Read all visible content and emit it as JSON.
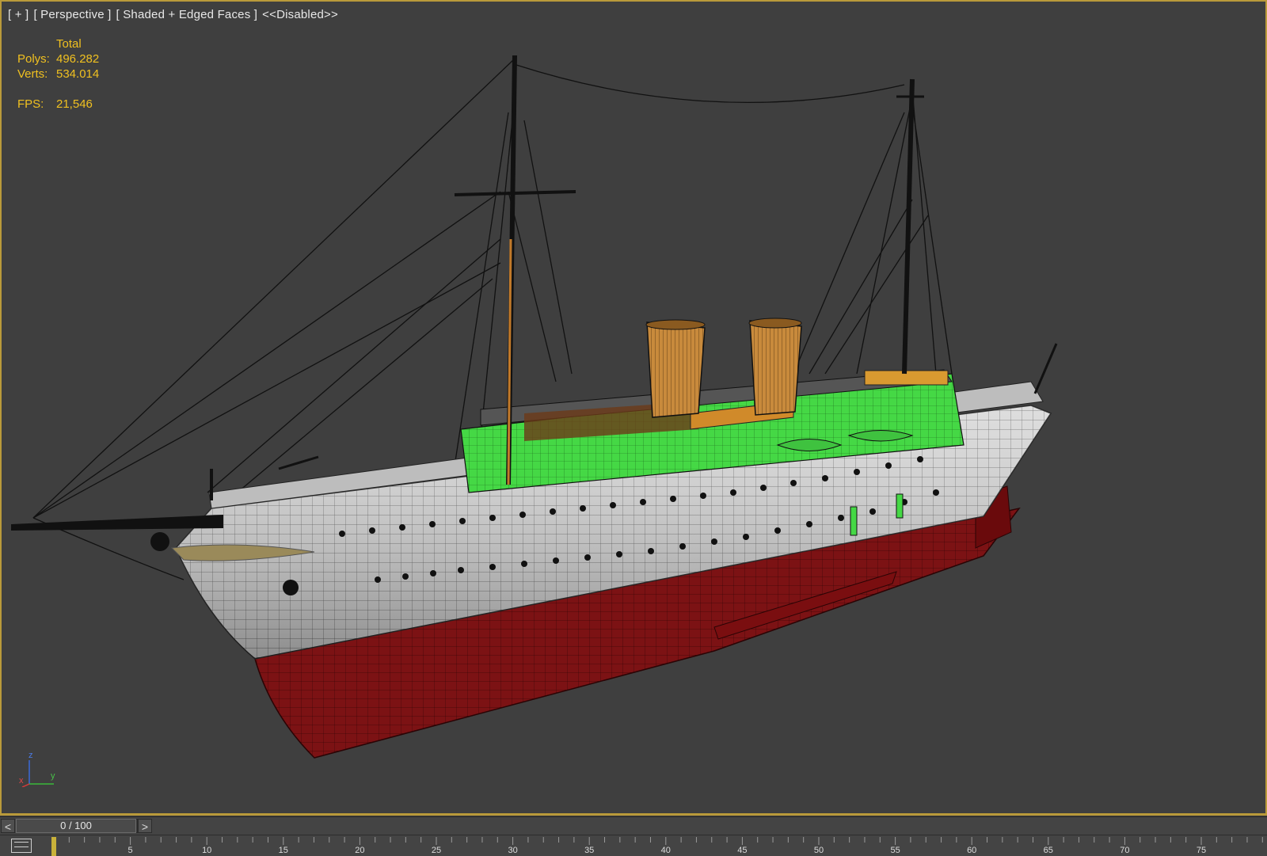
{
  "viewport": {
    "label_plus": "[ + ]",
    "label_view": "[ Perspective ]",
    "label_shading": "[ Shaded + Edged Faces ]",
    "label_disabled": "<<Disabled>>",
    "stats": {
      "total_label": "Total",
      "polys_label": "Polys:",
      "polys_value": "496.282",
      "verts_label": "Verts:",
      "verts_value": "534.014",
      "fps_label": "FPS:",
      "fps_value": "21,546"
    },
    "gizmo": {
      "z": "z",
      "x": "x",
      "y": "y"
    }
  },
  "time_slider": {
    "prev": "<",
    "next": ">",
    "frame_display": "0 / 100"
  },
  "trackbar": {
    "tick_labels": [
      "5",
      "10",
      "15",
      "20",
      "25",
      "30",
      "35",
      "40",
      "45",
      "50",
      "55",
      "60",
      "65",
      "70",
      "75"
    ]
  },
  "colors": {
    "viewport_border": "#b99a3a",
    "stats_text": "#f0c020",
    "hull_white": "#d6d6d6",
    "hull_red": "#7a0e10",
    "superstructure_green": "#3fd43f",
    "funnel_orange": "#c98a3a"
  }
}
